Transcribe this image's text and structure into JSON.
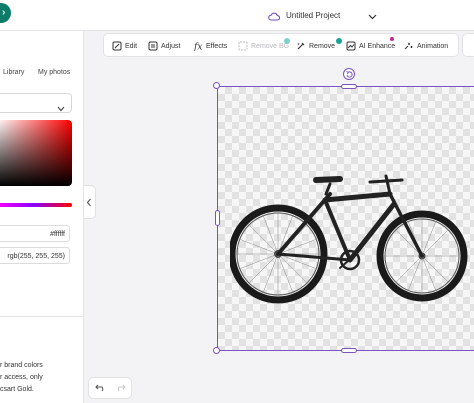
{
  "header": {
    "project_title": "Untitled Project",
    "logo_icon": "picsart-logo"
  },
  "left_panel": {
    "tabs": [
      {
        "label": "Library"
      },
      {
        "label": "My photos"
      }
    ],
    "color": {
      "hex": "#ffffff",
      "rgb": "rgb(255, 255, 255)"
    },
    "note_lines": [
      "r brand colors",
      "r access, only",
      "csart Gold."
    ]
  },
  "toolbar": {
    "items": [
      {
        "label": "Edit",
        "icon": "edit-icon"
      },
      {
        "label": "Adjust",
        "icon": "adjust-icon"
      },
      {
        "label": "Effects",
        "icon": "effects-icon"
      },
      {
        "label": "Remove BG",
        "icon": "remove-bg-icon",
        "disabled": true
      },
      {
        "label": "Remove",
        "icon": "remove-icon"
      },
      {
        "label": "AI Enhance",
        "icon": "ai-enhance-icon"
      },
      {
        "label": "Animation",
        "icon": "animation-icon"
      }
    ]
  },
  "colors": {
    "accent": "#7a52c2",
    "brand": "#0e7c6b",
    "badge_teal": "#17a39a",
    "badge_pink": "#c2278f"
  }
}
